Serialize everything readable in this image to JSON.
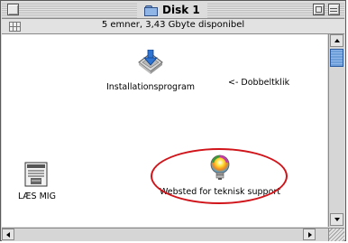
{
  "window": {
    "title": "Disk 1"
  },
  "status": {
    "text": "5 emner, 3,43 Gbyte disponibel"
  },
  "items": {
    "installer": {
      "label": "Installationsprogram",
      "icon": "installer-icon"
    },
    "readme": {
      "label": "LÆS MIG",
      "icon": "document-icon"
    },
    "support": {
      "label": "Websted for teknisk support",
      "icon": "lightbulb-icon"
    }
  },
  "annotation": {
    "text": "<- Dobbeltklik"
  },
  "colors": {
    "highlight_ellipse": "#d0141a",
    "scroll_thumb": "#6f9fd9"
  }
}
